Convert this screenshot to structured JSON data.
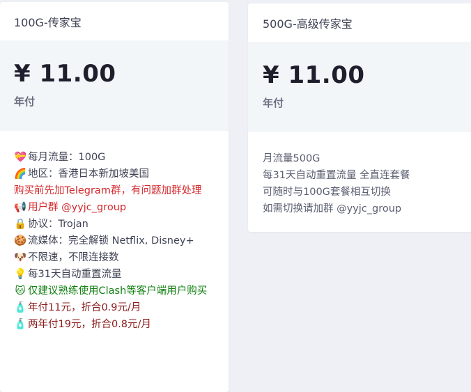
{
  "plans": [
    {
      "title": "100G-传家宝",
      "price": "¥ 11.00",
      "period": "年付",
      "features": [
        {
          "icon": "heart-gift-icon",
          "glyph": "💝",
          "text": "每月流量：100G",
          "color": "normal"
        },
        {
          "icon": "rainbow-icon",
          "glyph": "🌈",
          "text": "地区：香港日本新加坡美国",
          "color": "normal"
        },
        {
          "icon": "",
          "glyph": "",
          "text": "购买前先加Telegram群，有问题加群处理",
          "color": "red"
        },
        {
          "icon": "megaphone-icon",
          "glyph": "📢",
          "text": "用户群 @yyjc_group",
          "color": "red"
        },
        {
          "icon": "lock-icon",
          "glyph": "🔒",
          "text": "协议：Trojan",
          "color": "normal"
        },
        {
          "icon": "cookie-icon",
          "glyph": "🍪",
          "text": "流媒体：完全解锁 Netflix, Disney+",
          "color": "normal"
        },
        {
          "icon": "dog-icon",
          "glyph": "🐶",
          "text": "不限速，不限连接数",
          "color": "normal"
        },
        {
          "icon": "lightbulb-icon",
          "glyph": "💡",
          "text": "每31天自动重置流量",
          "color": "normal"
        },
        {
          "icon": "cat-icon",
          "glyph": "🐱",
          "text": "仅建议熟练使用Clash等客户端用户购买",
          "color": "green"
        },
        {
          "icon": "bottle-icon",
          "glyph": "🧴",
          "text": "年付11元，折合0.9元/月",
          "color": "dark-red"
        },
        {
          "icon": "bottle-icon",
          "glyph": "🧴",
          "text": "两年付19元，折合0.8元/月",
          "color": "dark-red"
        }
      ]
    },
    {
      "title": "500G-高级传家宝",
      "price": "¥ 11.00",
      "period": "年付",
      "features": [
        {
          "text": "月流量500G"
        },
        {
          "text": "每31天自动重置流量 全直连套餐"
        },
        {
          "text": "可随时与100G套餐相互切换"
        },
        {
          "text": "如需切换请加群 @yyjc_group"
        }
      ]
    }
  ],
  "colors": {
    "red": "#d4282c",
    "dark-red": "#8b1c1c",
    "green": "#128012",
    "price_bg": "#f3f6f9",
    "page_bg": "#eef0f5"
  }
}
